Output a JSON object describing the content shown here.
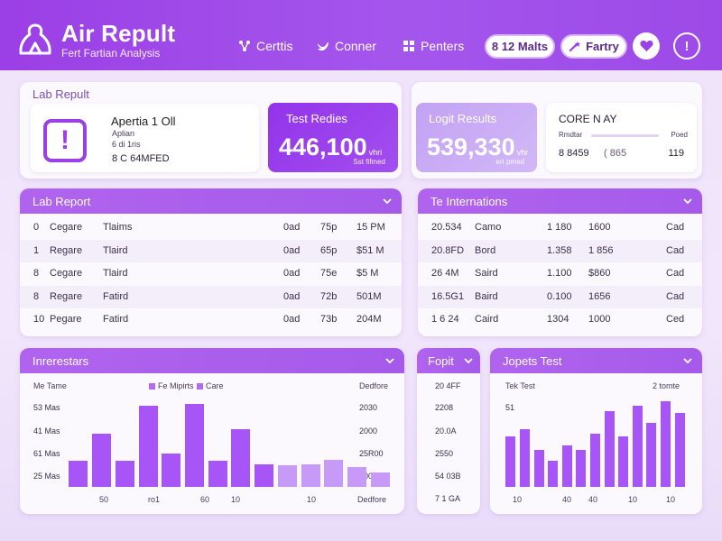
{
  "header": {
    "title": "Air Repult",
    "subtitle": "Fert Fartian Analysis",
    "nav": [
      {
        "label": "Certtis",
        "icon": "network-icon"
      },
      {
        "label": "Conner",
        "icon": "bird-icon"
      },
      {
        "label": "Penters",
        "icon": "grid-icon"
      }
    ],
    "count_pill": "8 12 Malts",
    "party_pill": "Fartry",
    "favorite_icon": "heart-icon",
    "info_icon": "info-icon",
    "info_symbol": "!"
  },
  "lab_result": {
    "label": "Lab Repult",
    "alert": {
      "title": "Apertia 1 Oll",
      "line1": "Aplian",
      "line2": "6 di 1ris",
      "line3": "8 C 64MFED",
      "icon": "alert-icon",
      "symbol": "!"
    },
    "test_results": {
      "title": "Test Redies",
      "value": "446,100",
      "unit": "vhri",
      "footer": "Sst fifmed"
    }
  },
  "logit_results": {
    "title": "Logit Results",
    "value": "539,330",
    "unit": "vhr",
    "footer": "ert pmed",
    "core": {
      "title": "CORE N AY",
      "left_label": "Rmdtar",
      "right_label": "Poed",
      "values": [
        "8 8459",
        "( 865",
        "119"
      ]
    }
  },
  "lab_report": {
    "title": "Lab Report",
    "rows": [
      [
        "0",
        "Cegare",
        "Tlaims",
        "0ad",
        "75p",
        "15 PM"
      ],
      [
        "1",
        "Regare",
        "Tlaird",
        "0ad",
        "65p",
        "$51 M"
      ],
      [
        "8",
        "Cegare",
        "Tlaird",
        "0ad",
        "75e",
        "$5 M"
      ],
      [
        "8",
        "Regare",
        "Fatird",
        "0ad",
        "72b",
        "501M"
      ],
      [
        "10",
        "Pegare",
        "Fatird",
        "0ad",
        "73b",
        "204M"
      ]
    ]
  },
  "te_internations": {
    "title": "Te Internations",
    "rows": [
      [
        "20.534",
        "Camo",
        "1 180",
        "1600",
        "Cad"
      ],
      [
        "20.8FD",
        "Bord",
        "1.358",
        "1 856",
        "Cad"
      ],
      [
        "26 4M",
        "Saird",
        "1.100",
        "$860",
        "Cad"
      ],
      [
        "16.5G1",
        "Baird",
        "0.100",
        "1656",
        "Cad"
      ],
      [
        "1 6 24",
        "Caird",
        "1304",
        "1000",
        "Ced"
      ]
    ]
  },
  "interesters": {
    "title": "Inrerestars",
    "col_label": "Me Tame",
    "legend": [
      "Fe Mipirts",
      "Care"
    ],
    "right_label": "Dedfore",
    "left_ticks": [
      "53 Mas",
      "41 Mas",
      "61 Mas",
      "25 Mas"
    ],
    "right_ticks": [
      "2030",
      "2000",
      "25R00",
      "2000"
    ],
    "x_labels": [
      "50",
      "ro1",
      "60",
      "10",
      "10",
      "Dedfore"
    ]
  },
  "fopit": {
    "title": "Fopit",
    "values": [
      "20 4FF",
      "2208",
      "20.0A",
      "2550",
      "54 03B",
      "7 1 GA"
    ]
  },
  "jopets": {
    "title": "Jopets Test",
    "left_label": "Tek Test",
    "right_label": "2 tomte",
    "y_label": "51",
    "x_labels": [
      "10",
      "40",
      "40",
      "10",
      "10"
    ]
  },
  "chart_data": [
    {
      "type": "bar",
      "title": "Inrerestars",
      "series": [
        {
          "name": "Fe Mipirts",
          "values": [
            30,
            60,
            30,
            92,
            38,
            94,
            30,
            65,
            26,
            24,
            26,
            31,
            22,
            16
          ]
        }
      ]
    },
    {
      "type": "bar",
      "title": "Jopets Test",
      "series": [
        {
          "values": [
            55,
            63,
            40,
            28,
            45,
            40,
            58,
            82,
            55,
            88,
            70,
            93,
            80
          ]
        }
      ]
    }
  ],
  "colors": {
    "primary": "#9b3fe6",
    "bar": "#a855f7",
    "bar_light": "#c89af8",
    "kpi_primary": "#9333ea",
    "kpi_light": "#c9a8f6"
  }
}
